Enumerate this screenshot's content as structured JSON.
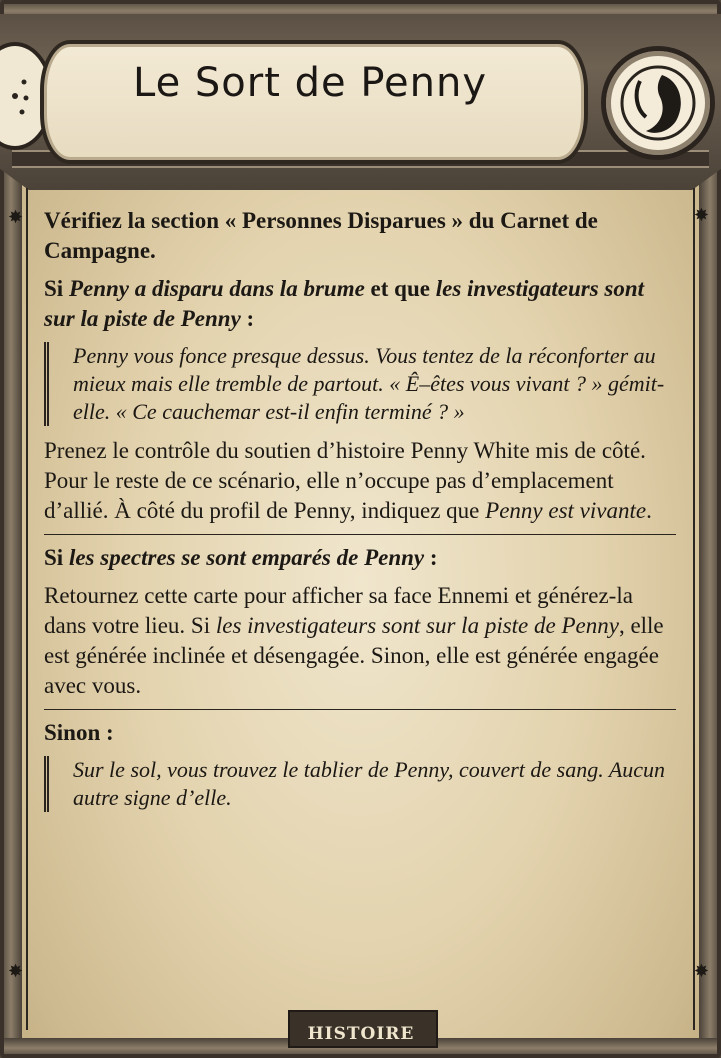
{
  "card": {
    "title": "Le Sort de Penny",
    "footer_label": "HISTOIRE",
    "accent_colors": {
      "frame": "#4a4138",
      "parchment": "#e3d3ae",
      "ink": "#1c1814"
    }
  },
  "content": {
    "intro": "Vérifiez la section « Personnes Disparues » du Carnet de Campagne.",
    "cond1": {
      "prefix": "Si ",
      "italic1": "Penny a disparu dans la brume",
      "mid": " et que ",
      "italic2": "les investigateurs sont sur la piste de Penny",
      "suffix": " :"
    },
    "quote1": "Penny vous fonce presque dessus. Vous tentez de la réconforter au mieux mais elle tremble de partout. « Ê–êtes vous vivant ? » gémit-elle. « Ce cauchemar est-il enfin terminé ? »",
    "para1": {
      "text": "Prenez le contrôle du soutien d’histoire Penny White mis de côté. Pour le reste de ce scénario, elle n’occupe pas d’emplacement d’allié. À côté du profil de Penny, indiquez que ",
      "italic": "Penny est vivante",
      "end": "."
    },
    "cond2": {
      "prefix": "Si ",
      "italic": "les spectres se sont emparés de Penny",
      "suffix": " :"
    },
    "para2": {
      "text1": "Retournez cette carte pour afficher sa face Ennemi et générez-la dans votre lieu. Si ",
      "italic": "les investigateurs sont sur la piste de Penny",
      "text2": ", elle est générée inclinée et désengagée. Sinon, elle est générée engagée avec vous."
    },
    "cond3": "Sinon :",
    "quote2": "Sur le sol, vous trouvez le tablier de Penny, couvert de sang. Aucun autre signe d’elle."
  },
  "icons": {
    "left_medallion": "star-circle-icon",
    "right_medallion": "moon-claw-icon",
    "corner": "star-icon"
  }
}
